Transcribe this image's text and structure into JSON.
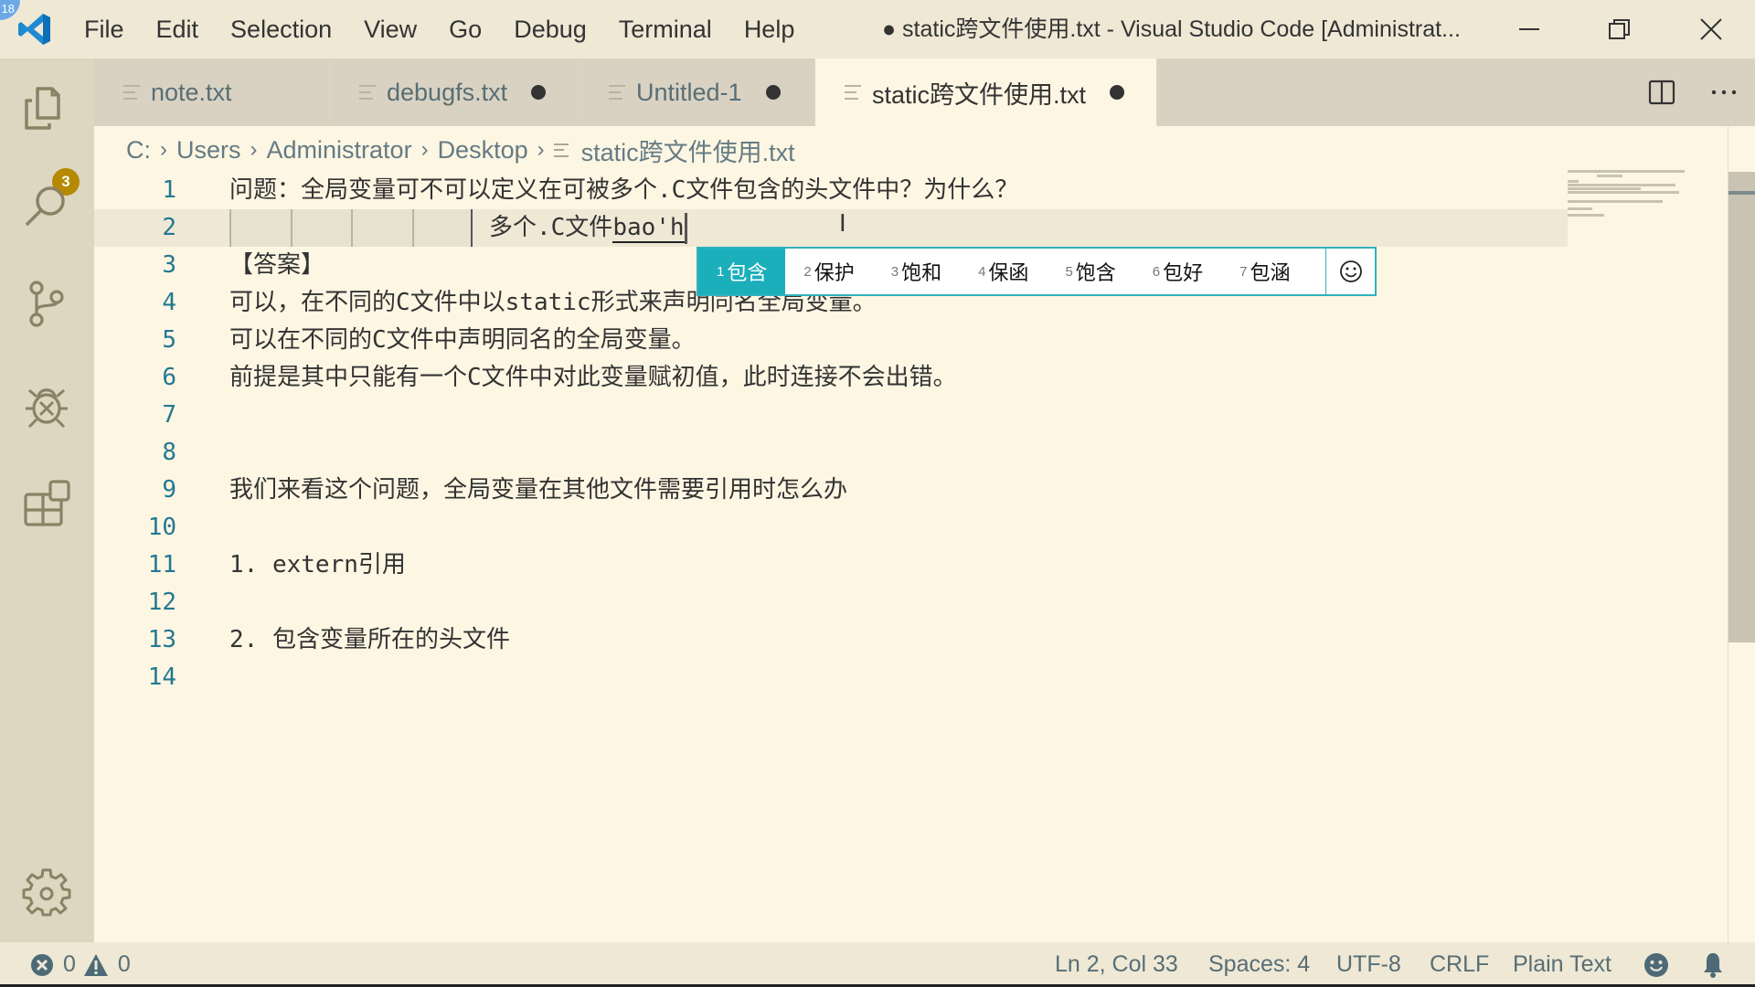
{
  "titlebar": {
    "menu": [
      "File",
      "Edit",
      "Selection",
      "View",
      "Go",
      "Debug",
      "Terminal",
      "Help"
    ],
    "window_title": "● static跨文件使用.txt - Visual Studio Code [Administrat...",
    "corner_badge": "18"
  },
  "activitybar": {
    "items": [
      {
        "name": "explorer",
        "badge": "3"
      },
      {
        "name": "search"
      },
      {
        "name": "source-control"
      },
      {
        "name": "debug"
      },
      {
        "name": "extensions"
      }
    ],
    "bottom": [
      {
        "name": "manage"
      }
    ]
  },
  "tabs": [
    {
      "label": "note.txt",
      "dirty": false,
      "active": false
    },
    {
      "label": "debugfs.txt",
      "dirty": true,
      "active": false
    },
    {
      "label": "Untitled-1",
      "dirty": true,
      "active": false
    },
    {
      "label": "static跨文件使用.txt",
      "dirty": true,
      "active": true
    }
  ],
  "breadcrumb": [
    "C:",
    "Users",
    "Administrator",
    "Desktop",
    "static跨文件使用.txt"
  ],
  "editor": {
    "lines": [
      {
        "n": "1",
        "text": "问题：全局变量可不可以定义在可被多个.C文件包含的头文件中？为什么？"
      },
      {
        "n": "2",
        "text": "多个.C文件",
        "composition": "bao'h",
        "indent_levels": 4
      },
      {
        "n": "3",
        "text": "【答案】"
      },
      {
        "n": "4",
        "text": "可以，在不同的C文件中以static形式来声明同名全局变量。"
      },
      {
        "n": "5",
        "text": "可以在不同的C文件中声明同名的全局变量。"
      },
      {
        "n": "6",
        "text": "前提是其中只能有一个C文件中对此变量赋初值，此时连接不会出错。"
      },
      {
        "n": "7",
        "text": ""
      },
      {
        "n": "8",
        "text": ""
      },
      {
        "n": "9",
        "text": "我们来看这个问题，全局变量在其他文件需要引用时怎么办"
      },
      {
        "n": "10",
        "text": ""
      },
      {
        "n": "11",
        "text": "1. extern引用"
      },
      {
        "n": "12",
        "text": ""
      },
      {
        "n": "13",
        "text": "2. 包含变量所在的头文件"
      },
      {
        "n": "14",
        "text": ""
      }
    ],
    "current_line": 2
  },
  "ime": {
    "candidates": [
      {
        "num": "1",
        "text": "包含",
        "selected": true
      },
      {
        "num": "2",
        "text": "保护"
      },
      {
        "num": "3",
        "text": "饱和"
      },
      {
        "num": "4",
        "text": "保函"
      },
      {
        "num": "5",
        "text": "饱含"
      },
      {
        "num": "6",
        "text": "包好"
      },
      {
        "num": "7",
        "text": "包涵"
      }
    ],
    "emoji_button": "☺"
  },
  "statusbar": {
    "errors": "0",
    "warnings": "0",
    "position": "Ln 2, Col 33",
    "spaces": "Spaces: 4",
    "encoding": "UTF-8",
    "eol": "CRLF",
    "language": "Plain Text"
  },
  "colors": {
    "editor_bg": "#fdf6e3",
    "chrome_bg": "#eee8d5",
    "activity_bg": "#ddd6c1",
    "badge": "#b58900",
    "line_number": "#237893",
    "ime_accent": "#1aafbb"
  }
}
